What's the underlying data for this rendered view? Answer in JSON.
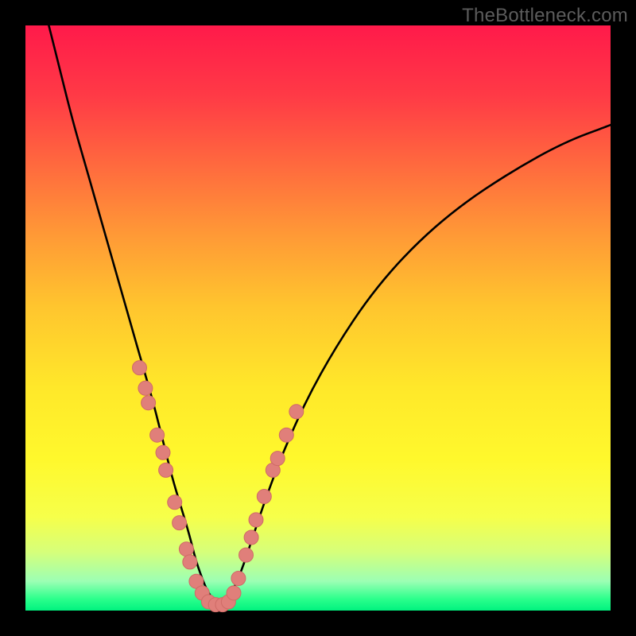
{
  "watermark": {
    "text": "TheBottleneck.com"
  },
  "colors": {
    "frame": "#000000",
    "curve": "#000000",
    "dot_fill": "#e07f7a",
    "dot_stroke": "#cf6b66"
  },
  "chart_data": {
    "type": "line",
    "title": "",
    "xlabel": "",
    "ylabel": "",
    "xlim": [
      0,
      100
    ],
    "ylim": [
      0,
      100
    ],
    "series": [
      {
        "name": "curve",
        "x": [
          4,
          6,
          8,
          10,
          12,
          14,
          16,
          18,
          20,
          22,
          23.5,
          25,
          26.5,
          28,
          29,
          30,
          31,
          32,
          33,
          34,
          35.5,
          37,
          39,
          41,
          44,
          48,
          53,
          59,
          66,
          74,
          83,
          92,
          100
        ],
        "y": [
          100,
          92,
          84,
          77,
          70,
          63,
          56,
          49,
          42,
          35,
          29,
          23,
          18,
          13,
          9,
          6,
          3.5,
          2,
          1.3,
          1.6,
          3.5,
          7,
          13,
          19,
          27,
          36,
          45,
          54,
          62,
          69,
          75,
          80,
          83
        ]
      }
    ],
    "points": {
      "name": "dots",
      "xy": [
        [
          19.5,
          41.5
        ],
        [
          20.5,
          38
        ],
        [
          21,
          35.5
        ],
        [
          22.5,
          30
        ],
        [
          23.5,
          27
        ],
        [
          24,
          24
        ],
        [
          25.5,
          18.5
        ],
        [
          26.3,
          15
        ],
        [
          27.5,
          10.5
        ],
        [
          28.1,
          8.3
        ],
        [
          29.2,
          5
        ],
        [
          30.2,
          3
        ],
        [
          31.3,
          1.5
        ],
        [
          32.5,
          1
        ],
        [
          33.7,
          1
        ],
        [
          34.7,
          1.5
        ],
        [
          35.6,
          3
        ],
        [
          36.4,
          5.5
        ],
        [
          37.7,
          9.5
        ],
        [
          38.6,
          12.5
        ],
        [
          39.4,
          15.5
        ],
        [
          40.8,
          19.5
        ],
        [
          42.3,
          24
        ],
        [
          43.1,
          26
        ],
        [
          44.6,
          30
        ],
        [
          46.3,
          34
        ]
      ]
    }
  }
}
